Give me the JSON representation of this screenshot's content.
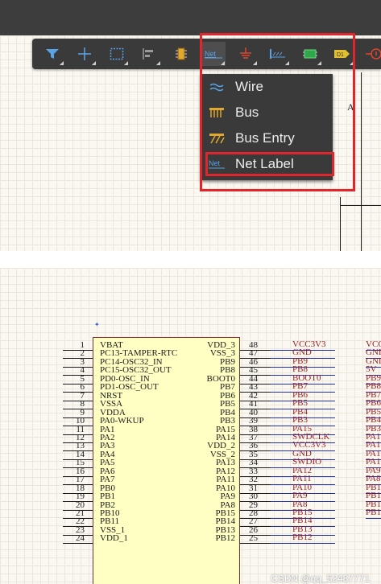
{
  "toolbar": {
    "buttons": [
      {
        "name": "filter-button",
        "icon": "filter-icon"
      },
      {
        "name": "crosshair-button",
        "icon": "crosshair-icon"
      },
      {
        "name": "select-area-button",
        "icon": "selection-rectangle-icon"
      },
      {
        "name": "align-button",
        "icon": "align-icon"
      },
      {
        "name": "component-button",
        "icon": "component-icon"
      },
      {
        "name": "net-label-tool-button",
        "icon": "net-label-icon",
        "label": "Net"
      },
      {
        "name": "power-port-button",
        "icon": "ground-icon"
      },
      {
        "name": "harness-button",
        "icon": "harness-icon"
      },
      {
        "name": "sheet-symbol-button",
        "icon": "sheet-symbol-icon"
      },
      {
        "name": "port-button",
        "icon": "port-icon",
        "label": "D1"
      },
      {
        "name": "directive-button",
        "icon": "directive-icon"
      }
    ]
  },
  "dropdown": {
    "items": [
      {
        "label": "Wire",
        "icon": "wire-icon"
      },
      {
        "label": "Bus",
        "icon": "bus-icon"
      },
      {
        "label": "Bus Entry",
        "icon": "bus-entry-icon"
      },
      {
        "label": "Net Label",
        "icon": "net-label-icon",
        "icon_text": "Net"
      }
    ]
  },
  "sheet": {
    "zone_letter": "A"
  },
  "schematic": {
    "pins": [
      {
        "num": "1",
        "left": "VBAT",
        "rnum": "48",
        "right": "VDD_3",
        "net": "VCC3V3",
        "net2": "VCC"
      },
      {
        "num": "2",
        "left": "PC13-TAMPER-RTC",
        "rnum": "47",
        "right": "VSS_3",
        "net": "GND",
        "net2": "GNI"
      },
      {
        "num": "3",
        "left": "PC14-OSC32_IN",
        "rnum": "46",
        "right": "PB9",
        "net": "PB9",
        "net2": "GNI"
      },
      {
        "num": "4",
        "left": "PC15-OSC32_OUT",
        "rnum": "45",
        "right": "PB8",
        "net": "PB8",
        "net2": "5V"
      },
      {
        "num": "5",
        "left": "PD0-OSC_IN",
        "rnum": "44",
        "right": "BOOT0",
        "net": "BOOT0",
        "net2": "PB9"
      },
      {
        "num": "6",
        "left": "PD1-OSC_OUT",
        "rnum": "43",
        "right": "PB7",
        "net": "PB7",
        "net2": "PB8"
      },
      {
        "num": "7",
        "left": "NRST",
        "rnum": "42",
        "right": "PB6",
        "net": "PB6",
        "net2": "PB7"
      },
      {
        "num": "8",
        "left": "VSSA",
        "rnum": "41",
        "right": "PB5",
        "net": "PB5",
        "net2": "PB6"
      },
      {
        "num": "9",
        "left": "VDDA",
        "rnum": "40",
        "right": "PB4",
        "net": "PB4",
        "net2": "PB5"
      },
      {
        "num": "10",
        "left": "PA0-WKUP",
        "rnum": "39",
        "right": "PB3",
        "net": "PB3",
        "net2": "PB4"
      },
      {
        "num": "11",
        "left": "PA1",
        "rnum": "38",
        "right": "PA15",
        "net": "PA15",
        "net2": "PB3"
      },
      {
        "num": "12",
        "left": "PA2",
        "rnum": "37",
        "right": "PA14",
        "net": "SWDCLK",
        "net2": "PA1"
      },
      {
        "num": "13",
        "left": "PA3",
        "rnum": "36",
        "right": "VDD_2",
        "net": "VCC3V3",
        "net2": "PA1"
      },
      {
        "num": "14",
        "left": "PA4",
        "rnum": "35",
        "right": "VSS_2",
        "net": "GND",
        "net2": "PA1"
      },
      {
        "num": "15",
        "left": "PA5",
        "rnum": "34",
        "right": "PA13",
        "net": "SWDIO",
        "net2": "PA1"
      },
      {
        "num": "16",
        "left": "PA6",
        "rnum": "33",
        "right": "PA12",
        "net": "PA12",
        "net2": "PA9"
      },
      {
        "num": "17",
        "left": "PA7",
        "rnum": "32",
        "right": "PA11",
        "net": "PA11",
        "net2": "PA8"
      },
      {
        "num": "18",
        "left": "PB0",
        "rnum": "31",
        "right": "PA10",
        "net": "PA10",
        "net2": "PB1"
      },
      {
        "num": "19",
        "left": "PB1",
        "rnum": "30",
        "right": "PA9",
        "net": "PA9",
        "net2": "PB1"
      },
      {
        "num": "20",
        "left": "PB2",
        "rnum": "29",
        "right": "PA8",
        "net": "PA8",
        "net2": "PB1"
      },
      {
        "num": "21",
        "left": "PB10",
        "rnum": "28",
        "right": "PB15",
        "net": "PB15",
        "net2": "PB1"
      },
      {
        "num": "22",
        "left": "PB11",
        "rnum": "27",
        "right": "PB14",
        "net": "PB14",
        "net2": ""
      },
      {
        "num": "23",
        "left": "VSS_1",
        "rnum": "26",
        "right": "PB13",
        "net": "PB13",
        "net2": ""
      },
      {
        "num": "24",
        "left": "VDD_1",
        "rnum": "25",
        "right": "PB12",
        "net": "PB12",
        "net2": ""
      }
    ]
  },
  "watermark": "CSDN @qq_52487771",
  "colors": {
    "highlight": "#e0262c",
    "toolbar": "#3a3a3a",
    "wire": "#1a1a1a",
    "bus_wire": "#2330a8",
    "net_label": "#9a1c1c",
    "chip_fill": "#ffffc4"
  }
}
